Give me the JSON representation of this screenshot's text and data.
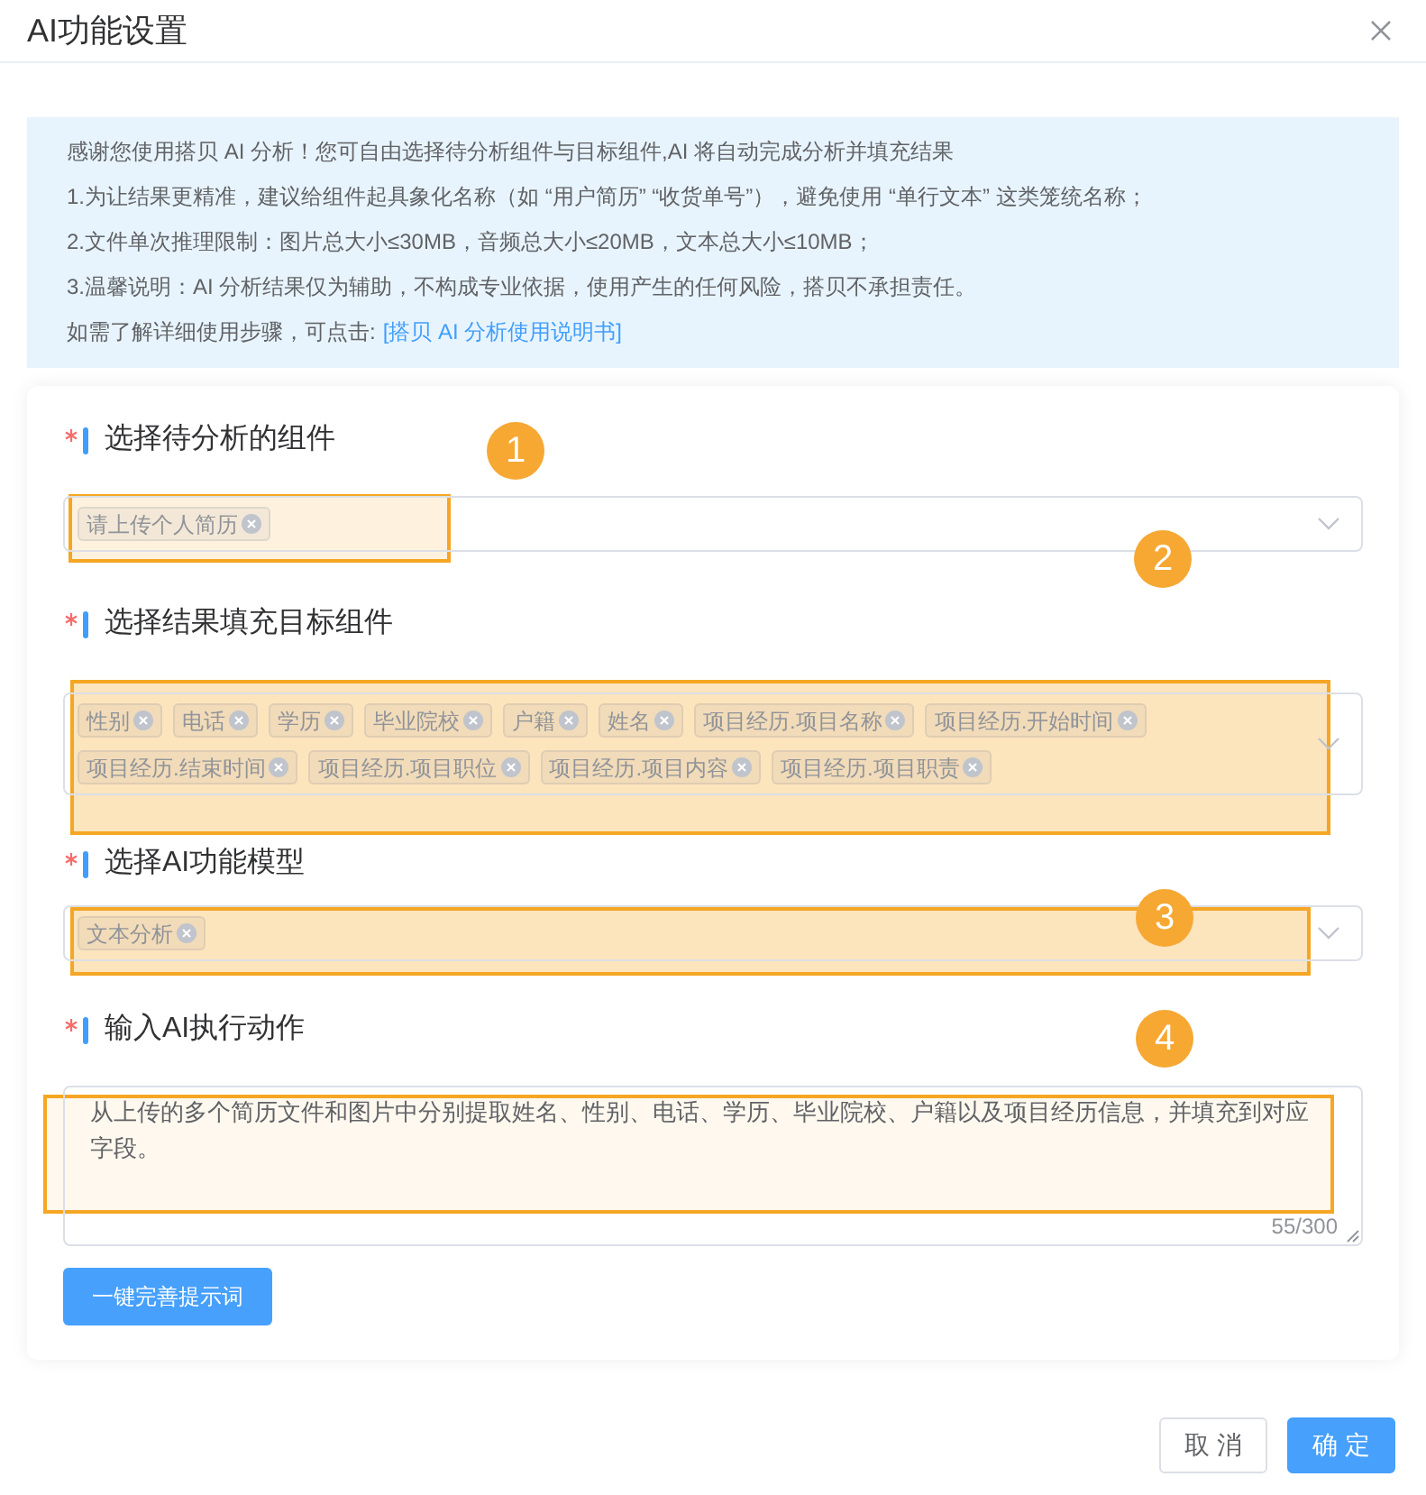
{
  "dialog": {
    "title": "AI功能设置"
  },
  "notice": {
    "lines": [
      "感谢您使用搭贝 AI 分析！您可自由选择待分析组件与目标组件,AI 将自动完成分析并填充结果",
      "1.为让结果更精准，建议给组件起具象化名称（如 “用户简历” “收货单号”），避免使用 “单行文本” 这类笼统名称；",
      "2.文件单次推理限制：图片总大小≤30MB，音频总大小≤20MB，文本总大小≤10MB；",
      "3.温馨说明：AI 分析结果仅为辅助，不构成专业依据，使用产生的任何风险，搭贝不承担责任。"
    ],
    "help_text": "如需了解详细使用步骤，可点击:",
    "help_link": "[搭贝 AI 分析使用说明书]"
  },
  "form": {
    "fields": [
      {
        "kind": "select",
        "label": "选择待分析的组件",
        "required": true,
        "tags": [
          "请上传个人简历"
        ]
      },
      {
        "kind": "select",
        "label": "选择结果填充目标组件",
        "required": true,
        "tags": [
          "性别",
          "电话",
          "学历",
          "毕业院校",
          "户籍",
          "姓名",
          "项目经历.项目名称",
          "项目经历.开始时间",
          "项目经历.结束时间",
          "项目经历.项目职位",
          "项目经历.项目内容",
          "项目经历.项目职责"
        ]
      },
      {
        "kind": "select",
        "label": "选择AI功能模型",
        "required": true,
        "tags": [
          "文本分析"
        ]
      },
      {
        "kind": "textarea",
        "label": "输入AI执行动作",
        "required": true,
        "value": "从上传的多个简历文件和图片中分别提取姓名、性别、电话、学历、毕业院校、户籍以及项目经历信息，并填充到对应字段。",
        "counter": "55/300"
      }
    ],
    "assist_button": "一键完善提示词"
  },
  "annotations": [
    {
      "label": "1"
    },
    {
      "label": "2"
    },
    {
      "label": "3"
    },
    {
      "label": "4"
    }
  ],
  "footer": {
    "buttons": [
      {
        "label": "取 消",
        "kind": "default"
      },
      {
        "label": "确 定",
        "kind": "primary"
      }
    ]
  }
}
